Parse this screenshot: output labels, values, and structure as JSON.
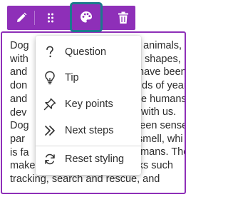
{
  "toolbar": {
    "edit_icon": "pencil-icon",
    "drag_icon": "drag-handle-icon",
    "style_icon": "palette-icon",
    "delete_icon": "trash-icon",
    "background_color": "#8e2fb8",
    "highlight_color": "#1b7a8c"
  },
  "menu": {
    "items": [
      {
        "label": "Question",
        "icon": "question-mark-icon"
      },
      {
        "label": "Tip",
        "icon": "lightbulb-icon"
      },
      {
        "label": "Key points",
        "icon": "pin-icon"
      },
      {
        "label": "Next steps",
        "icon": "chevrons-right-icon"
      }
    ],
    "reset": {
      "label": "Reset styling",
      "icon": "refresh-icon"
    }
  },
  "body_text": {
    "lines": [
      "Dog",
      "with",
      "and",
      "don",
      "and",
      "dev",
      "Dog",
      "par",
      "is fa",
      "makes them excellent at tasks such",
      "tracking, search and rescue, and"
    ],
    "right_fragments": [
      "e animals,",
      "shapes,",
      "have been",
      "ds of year",
      "e humans",
      "with us.",
      "keen sense",
      "smell, whi",
      "umans. The"
    ]
  }
}
